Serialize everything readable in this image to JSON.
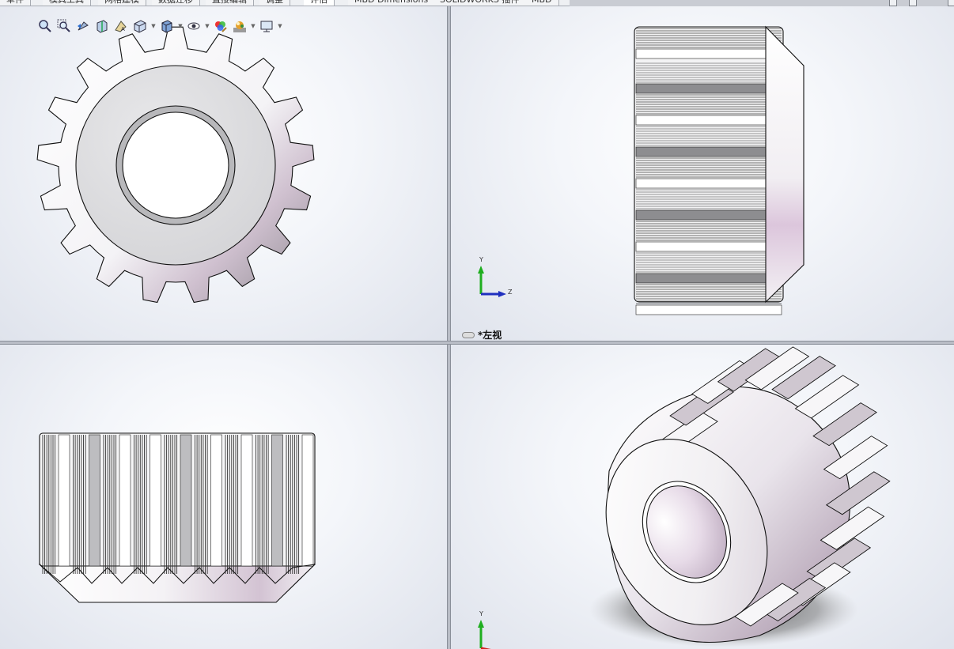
{
  "tabs": [
    {
      "label": "草件"
    },
    {
      "label": "模具工具"
    },
    {
      "label": "网格建模"
    },
    {
      "label": "数据迁移"
    },
    {
      "label": "直接编辑"
    },
    {
      "label": "调整"
    },
    {
      "label": "评估"
    },
    {
      "label": "MBD Dimensions"
    },
    {
      "label": "SOLIDWORKS 插件"
    },
    {
      "label": "MBD"
    }
  ],
  "hud_icons": [
    "zoom-to-fit-icon",
    "zoom-to-area-icon",
    "previous-view-icon",
    "section-view-icon",
    "dynamic-annotation-icon",
    "view-orientation-icon",
    "display-style-icon",
    "hide-show-items-icon",
    "edit-appearance-icon",
    "apply-scene-icon",
    "view-settings-icon"
  ],
  "viewports": {
    "top_right_label": "*左视"
  },
  "triad": {
    "y": "Y",
    "z": "Z"
  },
  "colors": {
    "axis_y": "#1fae1f",
    "axis_z": "#1f2fbf",
    "axis_x": "#d21f1f"
  }
}
